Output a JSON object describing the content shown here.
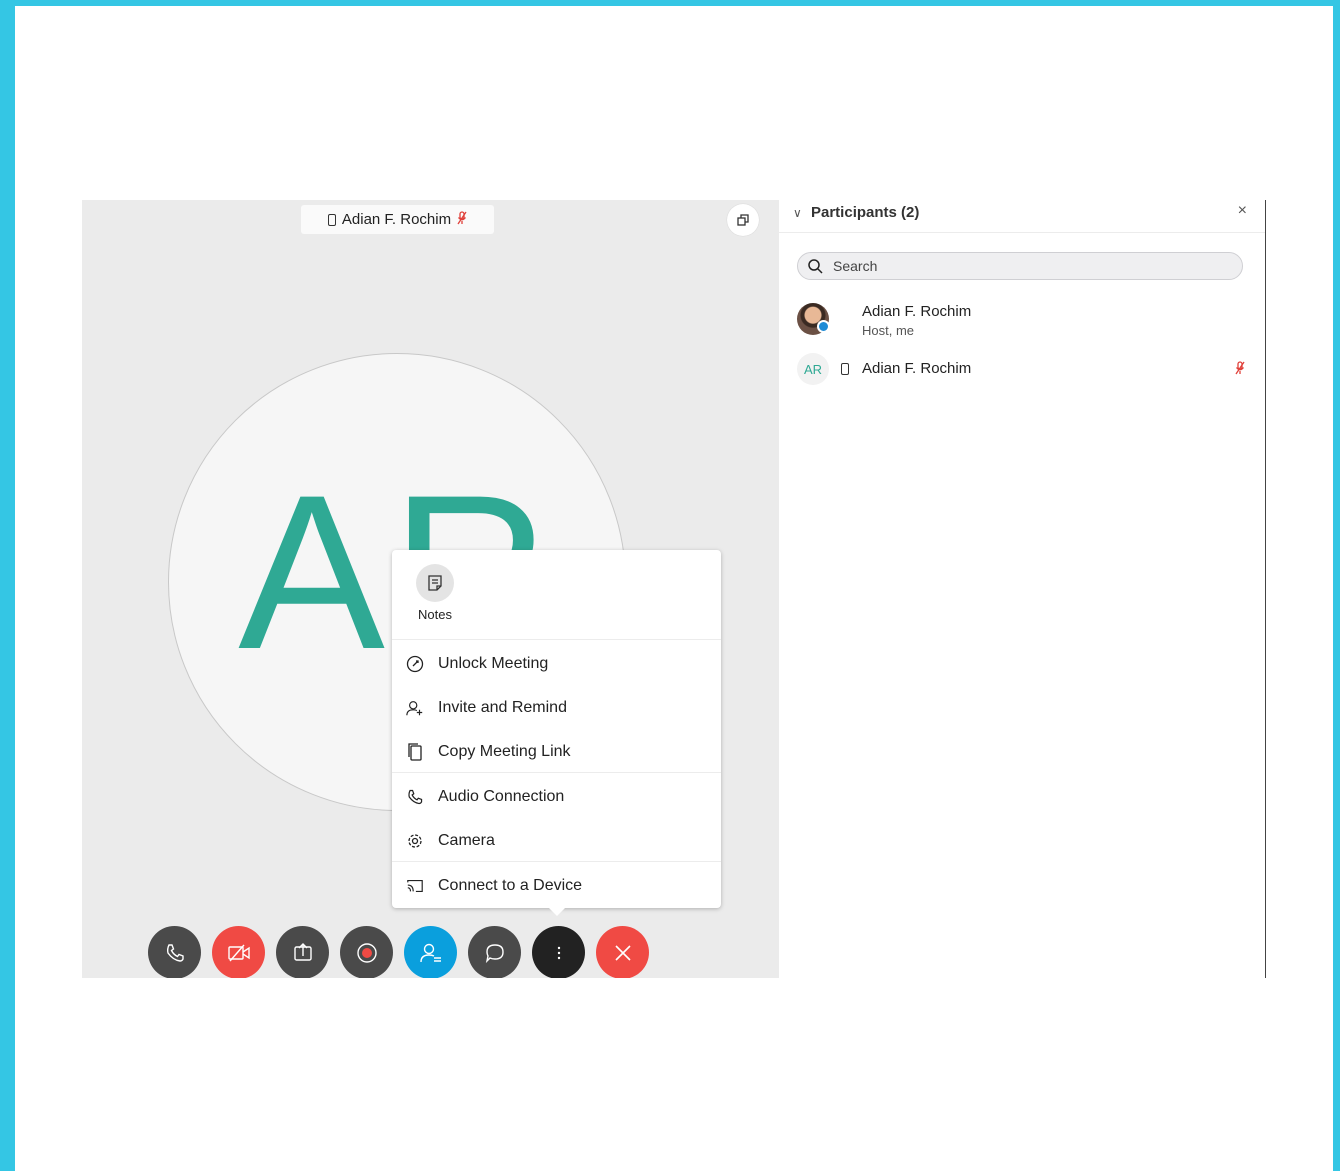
{
  "stage": {
    "speaker_name": "Adian F. Rochim",
    "avatar_initials": "AR"
  },
  "toolbar": {
    "buttons": [
      {
        "name": "audio-button",
        "icon": "phone-icon"
      },
      {
        "name": "video-off-button",
        "icon": "video-off-icon"
      },
      {
        "name": "share-button",
        "icon": "share-icon"
      },
      {
        "name": "record-button",
        "icon": "record-icon"
      },
      {
        "name": "participants-button",
        "icon": "participants-icon"
      },
      {
        "name": "chat-button",
        "icon": "chat-icon"
      },
      {
        "name": "more-button",
        "icon": "more-icon"
      },
      {
        "name": "leave-button",
        "icon": "close-icon"
      }
    ]
  },
  "popup": {
    "notes_label": "Notes",
    "items": [
      {
        "label": "Unlock Meeting",
        "icon": "unlock-icon"
      },
      {
        "label": "Invite and Remind",
        "icon": "invite-icon"
      },
      {
        "label": "Copy Meeting Link",
        "icon": "copy-icon"
      },
      {
        "label": "Audio Connection",
        "icon": "phone-icon"
      },
      {
        "label": "Camera",
        "icon": "gear-icon"
      },
      {
        "label": "Connect to a Device",
        "icon": "cast-icon"
      }
    ]
  },
  "panel": {
    "title": "Participants (2)",
    "search_placeholder": "Search",
    "participants": [
      {
        "name": "Adian F. Rochim",
        "subtitle": "Host, me"
      },
      {
        "name": "Adian F. Rochim",
        "initials": "AR"
      }
    ]
  },
  "colors": {
    "frame": "#34c6e4",
    "accent_green": "#2fa994",
    "red": "#f04a44",
    "blue": "#0a9fdd"
  }
}
